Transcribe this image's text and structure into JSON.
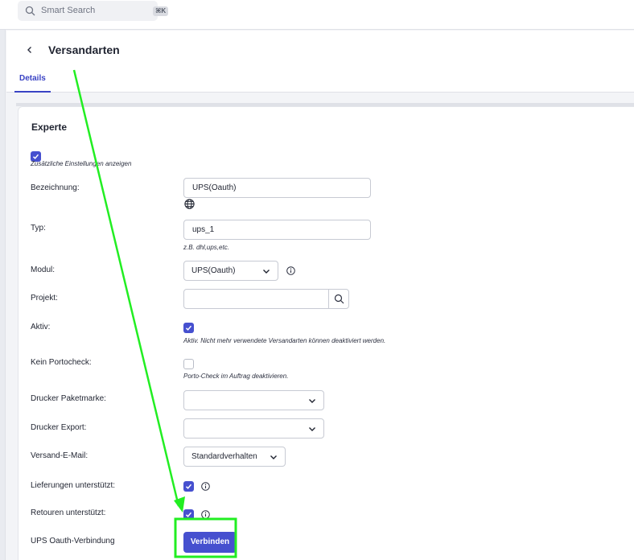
{
  "search": {
    "label": "Smart Search",
    "shortcut": "⌘K"
  },
  "header": {
    "title": "Versandarten",
    "tabs": [
      {
        "label": "Details",
        "active": true
      }
    ]
  },
  "section": {
    "title": "Experte",
    "extra_settings": {
      "checked": true,
      "label": "Zusätzliche Einstellungen anzeigen"
    }
  },
  "fields": {
    "bezeichnung": {
      "label": "Bezeichnung:",
      "value": "UPS(Oauth)"
    },
    "typ": {
      "label": "Typ:",
      "value": "ups_1",
      "hint": "z.B. dhl,ups,etc."
    },
    "modul": {
      "label": "Modul:",
      "value": "UPS(Oauth)"
    },
    "projekt": {
      "label": "Projekt:",
      "value": ""
    },
    "aktiv": {
      "label": "Aktiv:",
      "checked": true,
      "hint": "Aktiv. Nicht mehr verwendete Versandarten können deaktiviert werden."
    },
    "kein_portocheck": {
      "label": "Kein Portocheck:",
      "checked": false,
      "hint": "Porto-Check im Auftrag deaktivieren."
    },
    "drucker_paketmarke": {
      "label": "Drucker Paketmarke:",
      "value": ""
    },
    "drucker_export": {
      "label": "Drucker Export:",
      "value": ""
    },
    "versand_email": {
      "label": "Versand-E-Mail:",
      "value": "Standardverhalten"
    },
    "lieferungen": {
      "label": "Lieferungen unterstützt:",
      "checked": true
    },
    "retouren": {
      "label": "Retouren unterstützt:",
      "checked": true
    },
    "ups_oauth": {
      "label": "UPS Oauth-Verbindung",
      "button": "Verbinden"
    }
  },
  "colors": {
    "accent": "#4650cf",
    "annotation": "#22ee22"
  },
  "icons": [
    "search-icon",
    "chevron-left-icon",
    "globe-icon",
    "info-icon",
    "chevron-down-icon",
    "check-icon"
  ]
}
